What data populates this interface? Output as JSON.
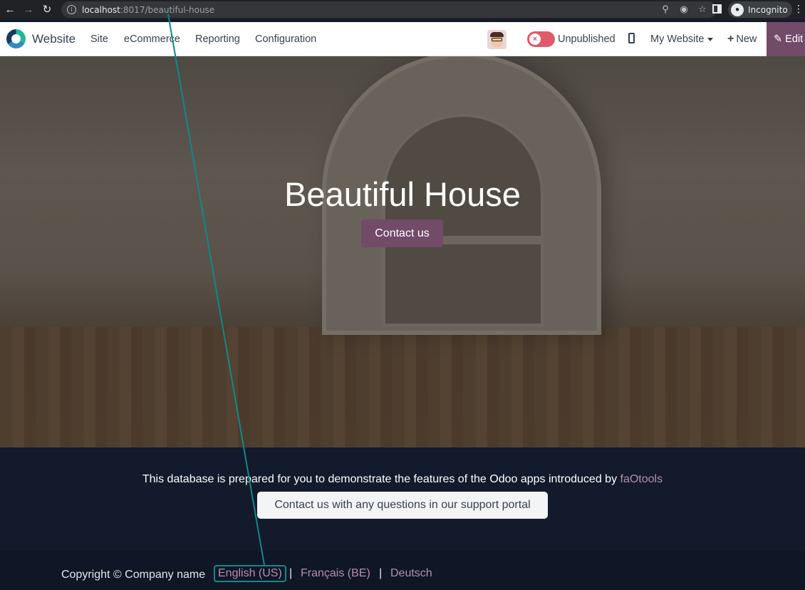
{
  "browser": {
    "url_host": "localhost",
    "url_path": ":8017/beautiful-house",
    "profile_label": "Incognito"
  },
  "topbar": {
    "app_name": "Website",
    "menu": [
      "Site",
      "eCommerce",
      "Reporting",
      "Configuration"
    ],
    "publish_status": "Unpublished",
    "website_selector": "My Website",
    "new_label": "New",
    "edit_label": "Edit"
  },
  "hero": {
    "title": "Beautiful House",
    "cta": "Contact us"
  },
  "footer": {
    "text": "This database is prepared for you to demonstrate the features of the Odoo apps introduced by ",
    "link": "faOtools",
    "support_button": "Contact us with any questions in our support portal"
  },
  "copyright": {
    "text": "Copyright © Company name",
    "languages": [
      "English (US)",
      "Français (BE)",
      "Deutsch"
    ],
    "separator": "|"
  },
  "colors": {
    "brand": "#714b67",
    "annotation": "#0e8a8a",
    "footer_bg": "#121a2b"
  }
}
